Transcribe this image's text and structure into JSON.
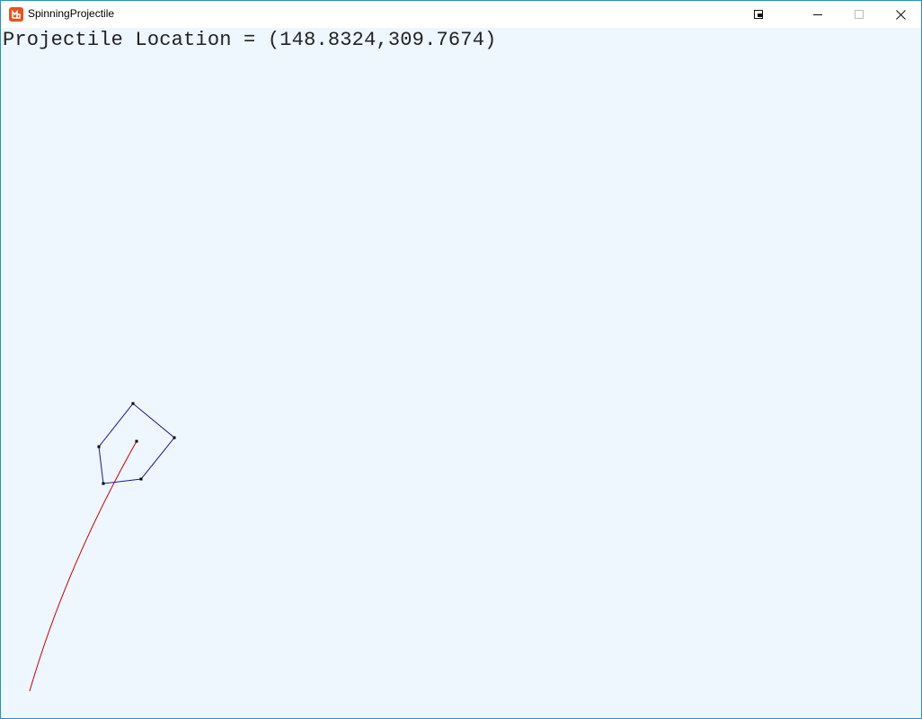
{
  "window": {
    "title": "SpinningProjectile",
    "accent_color": "#2b8fb8",
    "icon": "monogame-logo-icon",
    "controls": [
      "window-mode-icon",
      "minimize-icon",
      "maximize-icon",
      "close-icon"
    ]
  },
  "game": {
    "background_color": "#eef6fe",
    "readout_label": "Projectile Location = ",
    "projectile_location": "(148.8324,309.7674)",
    "polygon_color": "#1a1a8c",
    "trail_color": "#cc0000",
    "vertex_color": "#000000",
    "vertex_count": 5
  }
}
